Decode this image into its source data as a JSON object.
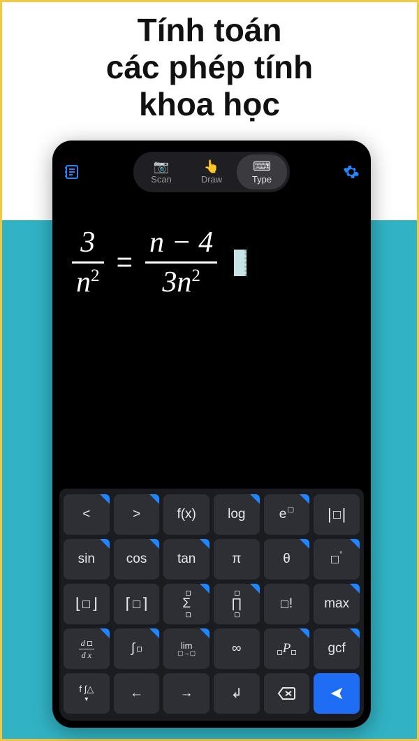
{
  "headline": "Tính toán\ncác phép tính\nkhoa học",
  "topbar": {
    "notes_icon": "notes-icon",
    "settings_icon": "gear-icon",
    "segments": {
      "scan": {
        "label": "Scan",
        "icon": "📷"
      },
      "draw": {
        "label": "Draw",
        "icon": "👆"
      },
      "type": {
        "label": "Type",
        "icon": "⌨",
        "active": true
      }
    }
  },
  "equation": {
    "left": {
      "numerator": "3",
      "denominator_base": "n",
      "denominator_exp": "2"
    },
    "right": {
      "numerator": "n − 4",
      "denom_coeff": "3",
      "denom_base": "n",
      "denom_exp": "2"
    },
    "equals": "="
  },
  "keyboard": {
    "rows": [
      [
        {
          "id": "lt",
          "label": "<",
          "tri": true
        },
        {
          "id": "gt",
          "label": ">",
          "tri": true
        },
        {
          "id": "fx",
          "label": "f(x)",
          "tri": false
        },
        {
          "id": "log",
          "label": "log",
          "tri": true
        },
        {
          "id": "epow",
          "html": "e<span class='supscript'>▢</span>",
          "tri": true
        },
        {
          "id": "abs",
          "html": "<span class='bracket'>|</span><span class='box'></span><span class='bracket'>|</span>",
          "tri": false
        }
      ],
      [
        {
          "id": "sin",
          "label": "sin",
          "tri": true
        },
        {
          "id": "cos",
          "label": "cos",
          "tri": true
        },
        {
          "id": "tan",
          "label": "tan",
          "tri": true
        },
        {
          "id": "pi",
          "label": "π",
          "tri": false
        },
        {
          "id": "theta",
          "label": "θ",
          "tri": true
        },
        {
          "id": "degree",
          "html": "<span class='box'></span><span class='supscript'>°</span>",
          "tri": true
        }
      ],
      [
        {
          "id": "floor",
          "html": "<span class='bracket'>⌊</span><span class='box'></span><span class='bracket'>⌋</span>",
          "tri": false
        },
        {
          "id": "ceil",
          "html": "<span class='bracket'>⌈</span><span class='box'></span><span class='bracket'>⌉</span>",
          "tri": false
        },
        {
          "id": "sigma",
          "html": "<span style='position:relative'><span class='boxsm' style='position:absolute;top:-8px;left:5px'></span>Σ<span class='boxsm' style='position:absolute;bottom:-8px;left:5px'></span></span>",
          "tri": true
        },
        {
          "id": "prod",
          "html": "<span style='position:relative'><span class='boxsm' style='position:absolute;top:-8px;left:5px'></span>∏<span class='boxsm' style='position:absolute;bottom:-8px;left:5px'></span></span>",
          "tri": true
        },
        {
          "id": "factorial",
          "html": "<span class='box'></span>!",
          "tri": false
        },
        {
          "id": "max",
          "label": "max",
          "tri": true
        }
      ],
      [
        {
          "id": "deriv",
          "html": "<span class='fracglyph'><span><span class='ital'>d</span> <span class='boxsm'></span></span><span class='fb'></span><span><span class='ital'>d x</span></span></span>",
          "tri": true
        },
        {
          "id": "integral",
          "html": "∫<span class='boxsm' style='margin-left:2px'></span>",
          "tri": true
        },
        {
          "id": "limit",
          "html": "<span style='font-size:13px;display:inline-flex;flex-direction:column;align-items:center;line-height:1'><span>lim</span><span style='font-size:9px'>▢→▢</span></span>",
          "tri": true
        },
        {
          "id": "infty",
          "label": "∞",
          "tri": false
        },
        {
          "id": "permute",
          "html": "<span class='boxsm subscript'></span><span class='ital'>P</span><span class='boxsm subscript'></span>",
          "tri": true
        },
        {
          "id": "gcf",
          "label": "gcf",
          "tri": true
        }
      ],
      [
        {
          "id": "more",
          "html": "<span style='display:inline-flex;flex-direction:column;align-items:center;gap:1px;font-size:13px'><span>f ∫△</span><span style='font-size:10px'>▾</span></span>",
          "tri": false
        },
        {
          "id": "left",
          "label": "←",
          "tri": false
        },
        {
          "id": "right",
          "label": "→",
          "tri": false
        },
        {
          "id": "newline",
          "label": "↲",
          "tri": false
        },
        {
          "id": "backspace",
          "label": "←",
          "bsicon": true
        },
        {
          "id": "submit",
          "label": "➤",
          "submit": true
        }
      ]
    ]
  }
}
